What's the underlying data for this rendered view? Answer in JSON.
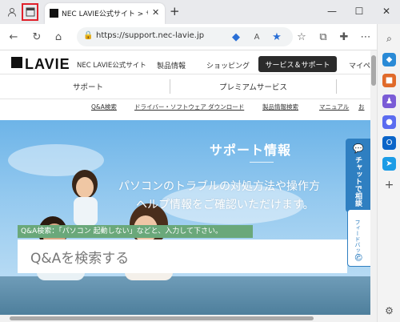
{
  "browser": {
    "tab_title": "NEC LAVIE公式サイト > サービス＆サ",
    "url": "https://support.nec-lavie.jp",
    "new_tab": "+",
    "icons": [
      "profile-icon",
      "tab-actions-icon",
      "nec-favicon",
      "close-icon",
      "back-icon",
      "refresh-icon",
      "home-icon",
      "lock-icon",
      "tag-icon",
      "read-aloud-icon",
      "favorite-star-icon",
      "favorites-icon",
      "collections-icon",
      "extensions-icon",
      "more-icon"
    ]
  },
  "header": {
    "logo": "LAVIE",
    "site_name": "NEC LAVIE公式サイト",
    "nav": [
      "製品情報",
      "ショッピング",
      "サービス＆サポート",
      "マイペ"
    ]
  },
  "subnav": [
    "サポート",
    "プレミアムサービス"
  ],
  "links": [
    "Q&A検索",
    "ドライバー・ソフトウェア ダウンロード",
    "製品情報検索",
    "マニュアル",
    "お"
  ],
  "hero": {
    "title": "サポート情報",
    "line1": "パソコンのトラブルの対処方法や操作方",
    "line2": "ヘルプ情報をご確認いただけます。"
  },
  "search": {
    "label": "Q&A検索：「パソコン 起動しない」などと、入力して下さい。",
    "placeholder": "Q&Aを検索する"
  },
  "side_tabs": {
    "chat": "チャットで相談",
    "feedback": "フィードバック"
  },
  "colors": {
    "highlight": "#e0202a",
    "chat_tab": "#2f7fc1",
    "search_label": "#6aa87a"
  }
}
